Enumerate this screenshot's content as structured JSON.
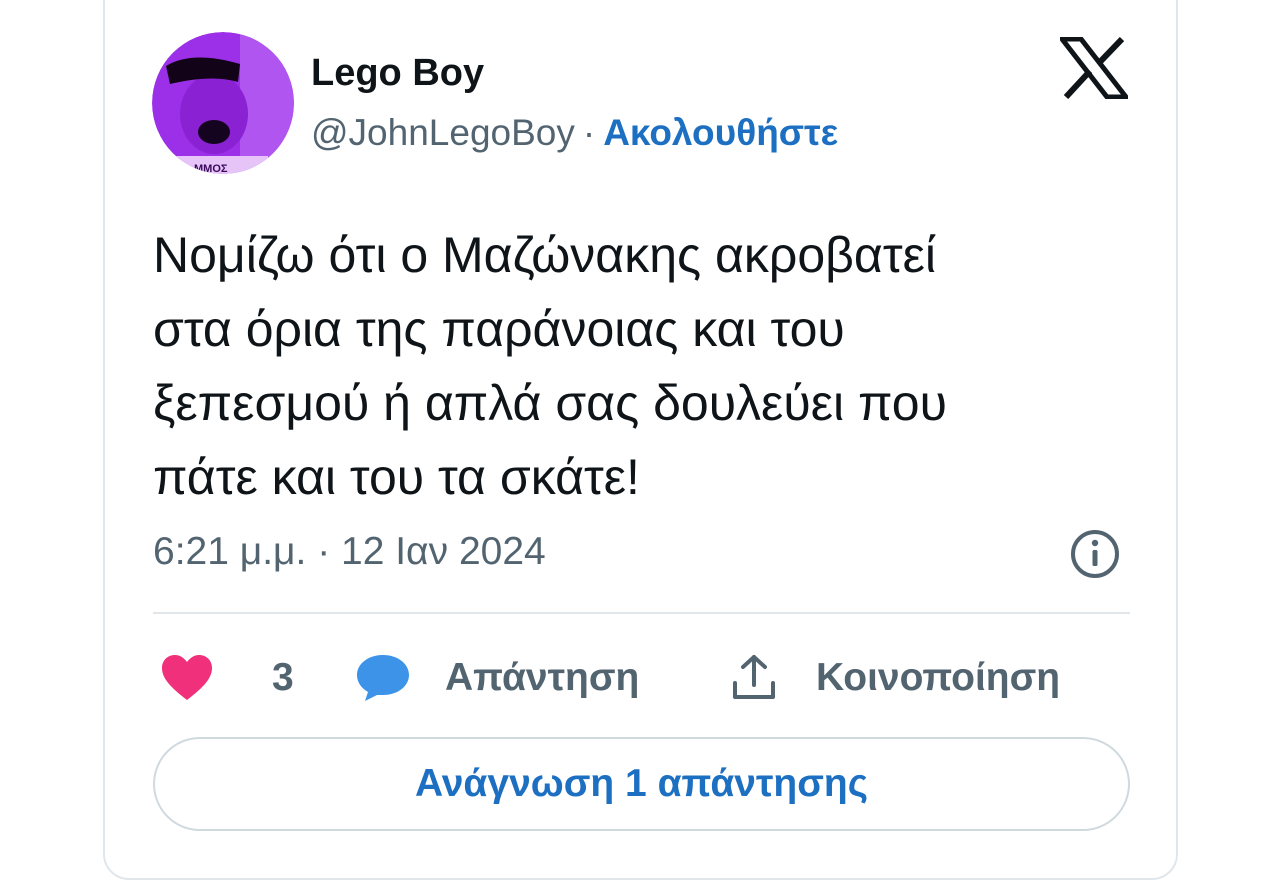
{
  "tweet": {
    "author": {
      "display_name": "Lego Boy",
      "handle": "@JohnLegoBoy",
      "separator": "·",
      "follow_label": "Ακολουθήστε"
    },
    "text_lines": [
      "Νομίζω ότι ο Μαζώνακης ακροβατεί",
      "στα όρια της παράνοιας και του",
      "ξεπεσμού ή απλά σας δουλεύει που",
      "πάτε και του τα σκάτε!"
    ],
    "timestamp": "6:21 μ.μ. · 12 Ιαν 2024",
    "actions": {
      "like_count": "3",
      "reply_label": "Απάντηση",
      "share_label": "Κοινοποίηση"
    },
    "read_replies_label": "Ανάγνωση 1 απάντησης"
  },
  "icons": {
    "brand": "x-logo-icon",
    "info": "info-icon",
    "like": "heart-icon",
    "reply": "speech-bubble-icon",
    "share": "share-upload-icon"
  },
  "colors": {
    "link_blue": "#1d6fc1",
    "like_pink": "#f0307a",
    "reply_blue": "#3d93e8",
    "secondary_text": "#536471",
    "avatar_purple": "#9b30e8"
  }
}
